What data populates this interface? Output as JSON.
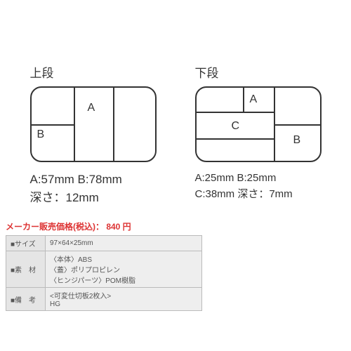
{
  "upper": {
    "title": "上段",
    "labelA": "A",
    "labelB": "B",
    "dims": "A:57mm  B:78mm\n深さ：12mm"
  },
  "lower": {
    "title": "下段",
    "labelA": "A",
    "labelB": "B",
    "labelC": "C",
    "dims": "A:25mm  B:25mm\nC:38mm 深さ：7mm"
  },
  "price": "メーカー販売価格(税込)： 840 円",
  "spec": {
    "size": {
      "k": "■サイズ",
      "v": "97×64×25mm"
    },
    "mat": {
      "k": "■素　材",
      "v": "〈本体〉ABS\n〈蓋〉ポリプロピレン\n〈ヒンジパーツ〉POM樹脂"
    },
    "note": {
      "k": "■備　考",
      "v": "<可変仕切板2枚入>\nHG"
    }
  },
  "chart_data": {
    "type": "table",
    "title": "Compartment dimensions",
    "tiers": [
      {
        "name": "上段",
        "A_mm": 57,
        "B_mm": 78,
        "depth_mm": 12
      },
      {
        "name": "下段",
        "A_mm": 25,
        "B_mm": 25,
        "C_mm": 38,
        "depth_mm": 7
      }
    ],
    "outer_size_mm": [
      97,
      64,
      25
    ],
    "price_jpy": 840
  }
}
